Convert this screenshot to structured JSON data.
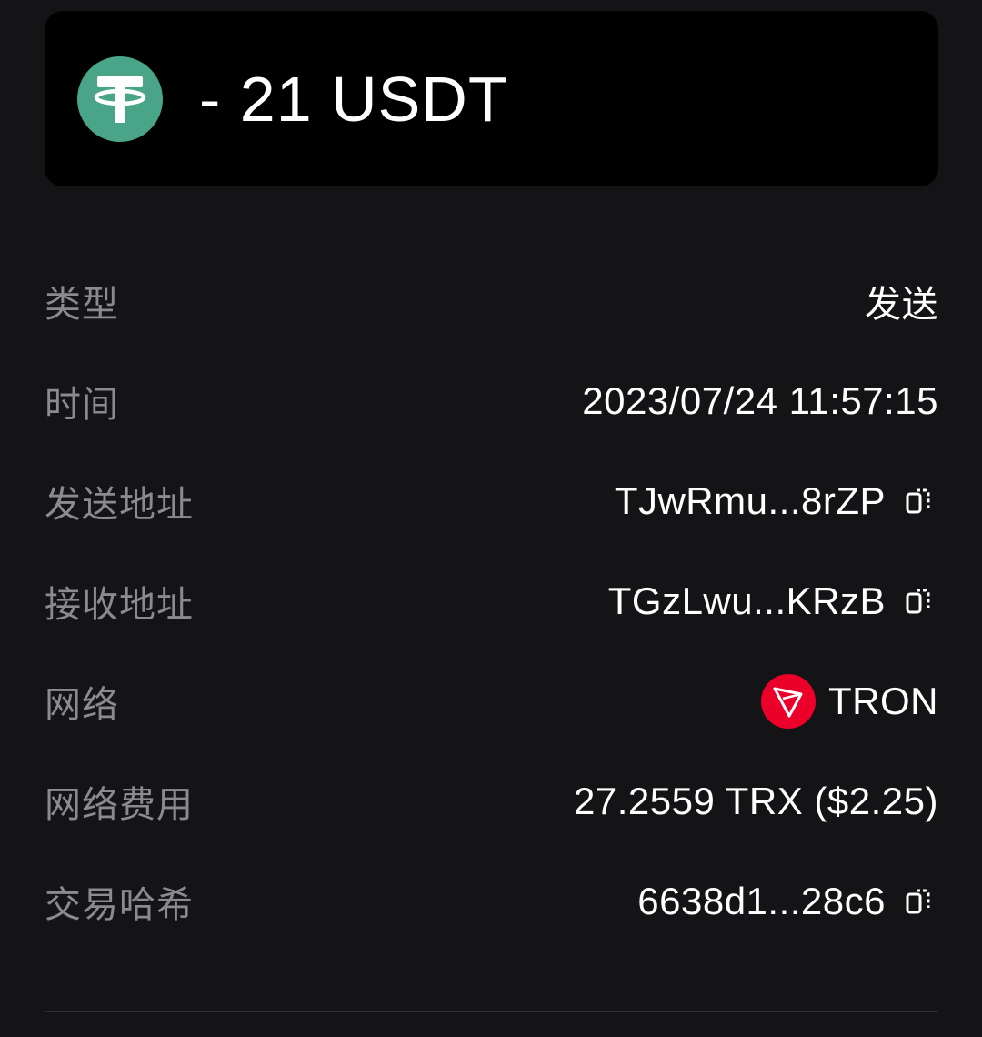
{
  "header": {
    "token_icon": "tether-usdt-icon",
    "amount": "- 21 USDT"
  },
  "details": {
    "type": {
      "label": "类型",
      "value": "发送"
    },
    "time": {
      "label": "时间",
      "value": "2023/07/24 11:57:15"
    },
    "from": {
      "label": "发送地址",
      "value": "TJwRmu...8rZP",
      "icon": "copy-icon"
    },
    "to": {
      "label": "接收地址",
      "value": "TGzLwu...KRzB",
      "icon": "copy-icon"
    },
    "network": {
      "label": "网络",
      "value": "TRON",
      "icon": "tron-icon"
    },
    "fee": {
      "label": "网络费用",
      "value": "27.2559 TRX ($2.25)"
    },
    "hash": {
      "label": "交易哈希",
      "value": "6638d1...28c6",
      "icon": "copy-icon"
    }
  },
  "colors": {
    "background": "#141316",
    "card": "#000000",
    "label": "#8b8a90",
    "tether_green": "#4aa487",
    "tron_red": "#eb0029"
  }
}
